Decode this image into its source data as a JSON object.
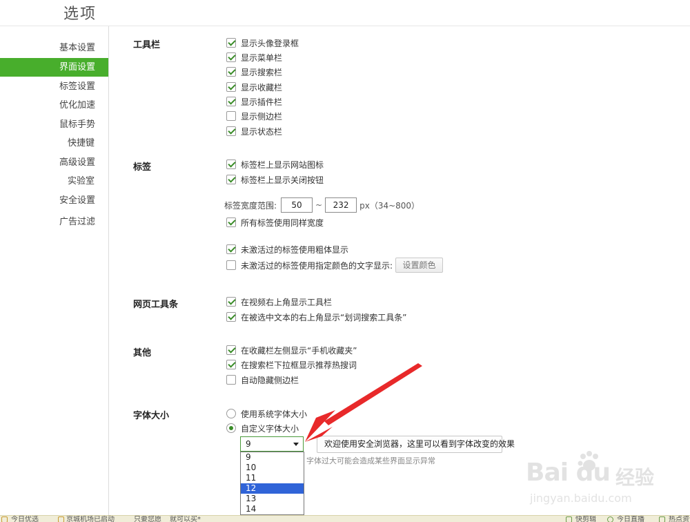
{
  "header": {
    "title": "选项"
  },
  "sidebar": {
    "items": [
      {
        "label": "基本设置",
        "active": false
      },
      {
        "label": "界面设置",
        "active": true
      },
      {
        "label": "标签设置",
        "active": false
      },
      {
        "label": "优化加速",
        "active": false
      },
      {
        "label": "鼠标手势",
        "active": false
      },
      {
        "label": "快捷键",
        "active": false
      },
      {
        "label": "高级设置",
        "active": false
      },
      {
        "label": "实验室",
        "active": false
      },
      {
        "label": "安全设置",
        "active": false
      },
      {
        "label": "广告过滤",
        "active": false
      }
    ]
  },
  "toolbar_section": {
    "title": "工具栏",
    "options": [
      {
        "label": "显示头像登录框",
        "checked": true
      },
      {
        "label": "显示菜单栏",
        "checked": true
      },
      {
        "label": "显示搜索栏",
        "checked": true
      },
      {
        "label": "显示收藏栏",
        "checked": true
      },
      {
        "label": "显示插件栏",
        "checked": true
      },
      {
        "label": "显示侧边栏",
        "checked": false
      },
      {
        "label": "显示状态栏",
        "checked": true
      }
    ]
  },
  "tabs_section": {
    "title": "标签",
    "options": [
      {
        "label": "标签栏上显示网站图标",
        "checked": true
      },
      {
        "label": "标签栏上显示关闭按钮",
        "checked": true
      }
    ],
    "width_range": {
      "label": "标签宽度范围:",
      "min": "50",
      "separator": "~",
      "max": "232",
      "hint": "px（34~800）"
    },
    "same_width": {
      "label": "所有标签使用同样宽度",
      "checked": true
    },
    "inactive_bold": {
      "label": "未激活过的标签使用粗体显示",
      "checked": true
    },
    "inactive_color": {
      "label": "未激活过的标签使用指定颜色的文字显示:",
      "checked": false
    },
    "set_color_button": "设置颜色"
  },
  "webtoolbar_section": {
    "title": "网页工具条",
    "options": [
      {
        "label": "在视频右上角显示工具栏",
        "checked": true
      },
      {
        "label": "在被选中文本的右上角显示“划词搜索工具条”",
        "checked": true
      }
    ]
  },
  "other_section": {
    "title": "其他",
    "options": [
      {
        "label": "在收藏栏左侧显示“手机收藏夹”",
        "checked": true
      },
      {
        "label": "在搜索栏下拉框显示推荐热搜词",
        "checked": true
      },
      {
        "label": "自动隐藏侧边栏",
        "checked": false
      }
    ]
  },
  "font_section": {
    "title": "字体大小",
    "radios": [
      {
        "label": "使用系统字体大小",
        "checked": false
      },
      {
        "label": "自定义字体大小",
        "checked": true
      }
    ],
    "selected_size": "9",
    "options": [
      "9",
      "10",
      "11",
      "12",
      "13",
      "14"
    ],
    "highlighted_option": "12",
    "preview_text": "欢迎使用安全浏览器，这里可以看到字体改变的效果",
    "warning": "字体过大可能会造成某些界面显示异常"
  },
  "watermark": {
    "logo": "Bai du",
    "brand": "经验",
    "url": "jingyan.baidu.com"
  },
  "status_bar": {
    "items": [
      "今日优选",
      "京城机场已启动",
      "只要您愿",
      "就可以买*",
      "快剪辑",
      "今日直播",
      "热点资讯"
    ]
  },
  "colors": {
    "accent": "#48ae2c",
    "check": "#3a8c28",
    "highlight": "#3064d8",
    "arrow": "#e8292a"
  }
}
